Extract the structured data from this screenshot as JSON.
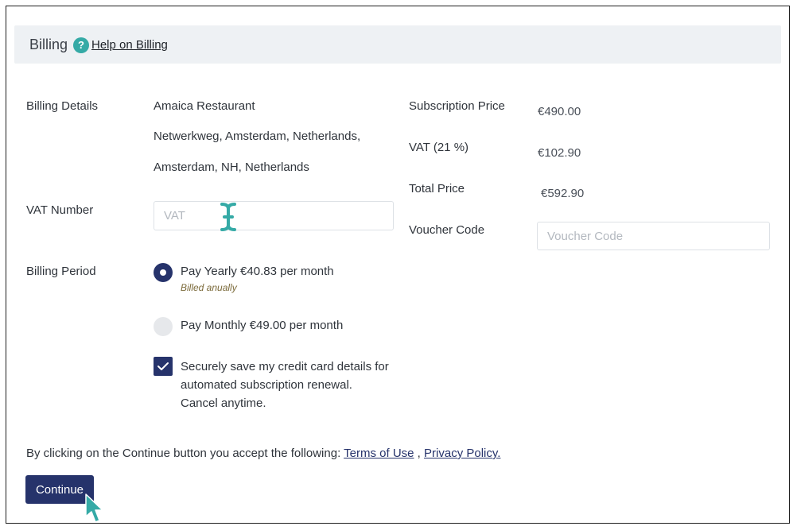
{
  "header": {
    "title": "Billing",
    "help_icon_glyph": "?",
    "help_link": "Help on Billing"
  },
  "billing_details": {
    "label": "Billing Details",
    "line1": "Amaica Restaurant",
    "line2": "Netwerkweg, Amsterdam, Netherlands,",
    "line3": "Amsterdam, NH, Netherlands"
  },
  "vat_number": {
    "label": "VAT Number",
    "placeholder": "VAT",
    "value": ""
  },
  "summary": {
    "subscription_price_label": "Subscription Price",
    "subscription_price": "€490.00",
    "vat_label": "VAT (21 %)",
    "vat_amount": "€102.90",
    "total_label": "Total Price",
    "total_amount": "€592.90",
    "voucher_label": "Voucher Code",
    "voucher_placeholder": "Voucher Code"
  },
  "billing_period": {
    "label": "Billing Period",
    "options": [
      {
        "label": "Pay Yearly €40.83 per month",
        "note": "Billed anually",
        "selected": true
      },
      {
        "label": "Pay Monthly €49.00 per month",
        "selected": false
      }
    ]
  },
  "save_card": {
    "checked": true,
    "line1": "Securely save my credit card details for",
    "line2": "automated subscription renewal.",
    "line3": "Cancel anytime."
  },
  "terms": {
    "text": "By clicking on the Continue button you accept the following: ",
    "terms_link": "Terms of Use",
    "separator": " , ",
    "privacy_link": "Privacy Policy."
  },
  "continue_label": "Continue",
  "colors": {
    "accent": "#26336b",
    "teal": "#35aaa6",
    "header_bg": "#eef1f4"
  },
  "icons": {
    "help": "question-circle-icon",
    "checkmark": "check-icon",
    "text_cursor": "i-beam-cursor-icon",
    "mouse_pointer": "arrow-pointer-icon"
  }
}
